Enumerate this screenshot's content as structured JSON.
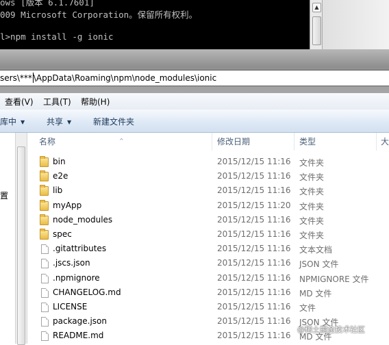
{
  "console": {
    "lines": [
      "ows [版本 6.1.7601]",
      "009 Microsoft Corporation。保留所有权利。",
      "",
      "l>npm install -g ionic"
    ],
    "scroll_up_glyph": "▲"
  },
  "address": {
    "prefix": "sers\\***",
    "suffix": "\\AppData\\Roaming\\npm\\node_modules\\ionic"
  },
  "menubar": {
    "items": [
      "查看(V)",
      "工具(T)",
      "帮助(H)"
    ]
  },
  "toolbar": {
    "library_label": "库中",
    "share_label": "共享",
    "new_folder_label": "新建文件夹",
    "dropdown_glyph": "▼"
  },
  "nav": {
    "partial_label": "置"
  },
  "columns": {
    "name": "名称",
    "date": "修改日期",
    "type": "类型",
    "size": "大",
    "sort_glyph": "^"
  },
  "files": [
    {
      "name": "bin",
      "date": "2015/12/15 11:16",
      "type": "文件夹",
      "kind": "folder"
    },
    {
      "name": "e2e",
      "date": "2015/12/15 11:16",
      "type": "文件夹",
      "kind": "folder"
    },
    {
      "name": "lib",
      "date": "2015/12/15 11:16",
      "type": "文件夹",
      "kind": "folder"
    },
    {
      "name": "myApp",
      "date": "2015/12/15 11:20",
      "type": "文件夹",
      "kind": "folder"
    },
    {
      "name": "node_modules",
      "date": "2015/12/15 11:16",
      "type": "文件夹",
      "kind": "folder"
    },
    {
      "name": "spec",
      "date": "2015/12/15 11:16",
      "type": "文件夹",
      "kind": "folder"
    },
    {
      "name": ".gitattributes",
      "date": "2015/12/15 11:16",
      "type": "文本文档",
      "kind": "file"
    },
    {
      "name": ".jscs.json",
      "date": "2015/12/15 11:16",
      "type": "JSON 文件",
      "kind": "file"
    },
    {
      "name": ".npmignore",
      "date": "2015/12/15 11:16",
      "type": "NPMIGNORE 文件",
      "kind": "file"
    },
    {
      "name": "CHANGELOG.md",
      "date": "2015/12/15 11:16",
      "type": "MD 文件",
      "kind": "file"
    },
    {
      "name": "LICENSE",
      "date": "2015/12/15 11:16",
      "type": "文件",
      "kind": "file"
    },
    {
      "name": "package.json",
      "date": "2015/12/15 11:16",
      "type": "JSON 文件",
      "kind": "file"
    },
    {
      "name": "README.md",
      "date": "2015/12/15 11:16",
      "type": "MD 文件",
      "kind": "file"
    }
  ],
  "watermark": "@稀土掘金技术社区"
}
